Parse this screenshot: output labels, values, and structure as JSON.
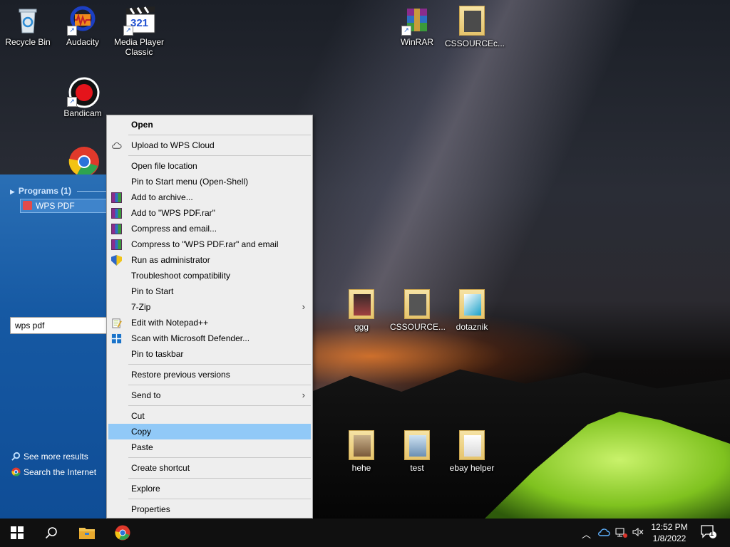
{
  "desktop": {
    "icons": {
      "recycle_bin": "Recycle Bin",
      "audacity": "Audacity",
      "media_player_classic": "Media Player Classic",
      "bandicam": "Bandicam",
      "winrar": "WinRAR",
      "cssource_top": "CSSOURCEc...",
      "ggg": "ggg",
      "cssource_mid": "CSSOURCE...",
      "dotaznik": "dotaznik",
      "hehe": "hehe",
      "test": "test",
      "ebay_helper": "ebay helper"
    },
    "mpc_badge": "321"
  },
  "start_menu": {
    "programs_header": "Programs (1)",
    "result": "WPS PDF",
    "see_more": "See more results",
    "search_internet": "Search the Internet",
    "search_value": "wps pdf"
  },
  "context_menu": {
    "open": "Open",
    "upload_wps_cloud": "Upload to WPS Cloud",
    "open_file_location": "Open file location",
    "pin_start_open_shell": "Pin to Start menu (Open-Shell)",
    "add_to_archive": "Add to archive...",
    "add_to_rar": "Add to \"WPS PDF.rar\"",
    "compress_email": "Compress and email...",
    "compress_rar_email": "Compress to \"WPS PDF.rar\" and email",
    "run_as_admin": "Run as administrator",
    "troubleshoot": "Troubleshoot compatibility",
    "pin_to_start": "Pin to Start",
    "seven_zip": "7-Zip",
    "edit_notepadpp": "Edit with Notepad++",
    "scan_defender": "Scan with Microsoft Defender...",
    "pin_taskbar": "Pin to taskbar",
    "restore_versions": "Restore previous versions",
    "send_to": "Send to",
    "cut": "Cut",
    "copy": "Copy",
    "paste": "Paste",
    "create_shortcut": "Create shortcut",
    "explore": "Explore",
    "properties": "Properties",
    "submenu_arrow": "›"
  },
  "taskbar": {
    "time": "12:52 PM",
    "date": "1/8/2022",
    "notification_count": "1"
  },
  "colors": {
    "highlight": "#91c9f7",
    "start_menu_blue": "#1659a3"
  }
}
